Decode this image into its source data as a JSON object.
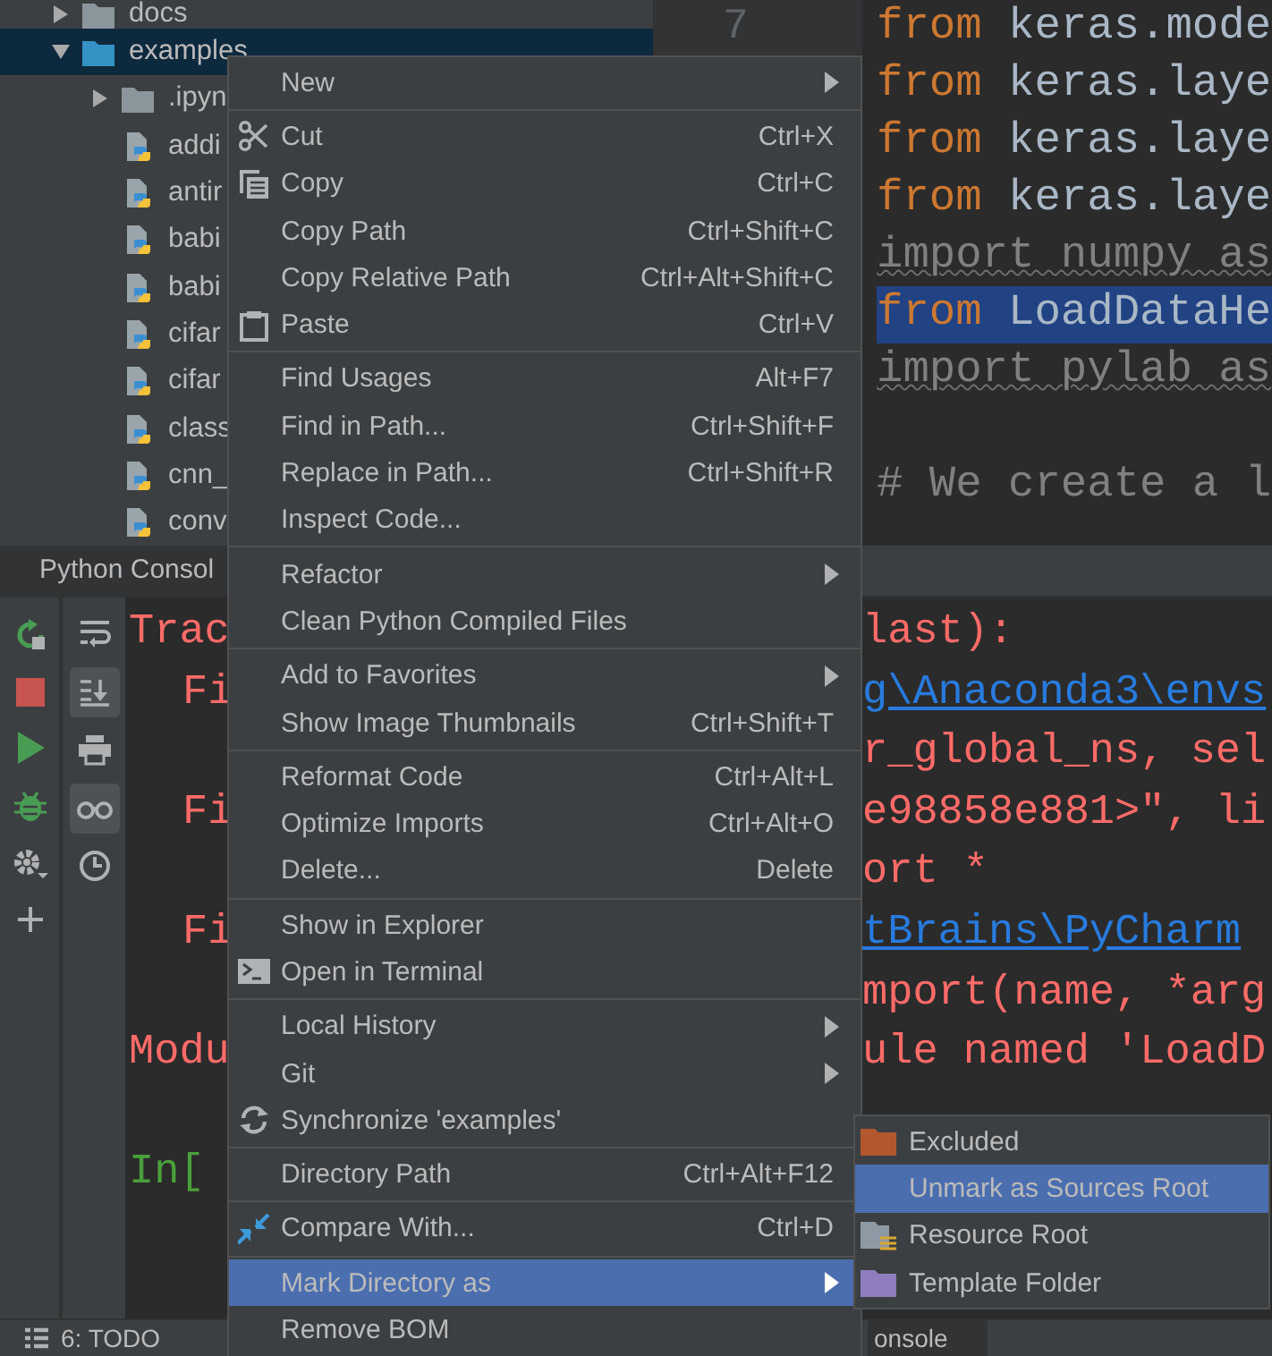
{
  "project_tree": {
    "items": [
      {
        "label": "docs",
        "kind": "folder",
        "expanded": false,
        "selected": false
      },
      {
        "label": "examples",
        "kind": "folder",
        "expanded": true,
        "selected": true,
        "children": [
          {
            "label": ".ipyn",
            "kind": "folder",
            "expanded": false,
            "selected": false
          },
          {
            "label": "addi",
            "kind": "python_file",
            "selected": false
          },
          {
            "label": "antir",
            "kind": "python_file",
            "selected": false
          },
          {
            "label": "babi",
            "kind": "python_file",
            "selected": false
          },
          {
            "label": "babi",
            "kind": "python_file",
            "selected": false
          },
          {
            "label": "cifar",
            "kind": "python_file",
            "selected": false
          },
          {
            "label": "cifar",
            "kind": "python_file",
            "selected": false
          },
          {
            "label": "class",
            "kind": "python_file",
            "selected": false
          },
          {
            "label": "cnn_",
            "kind": "python_file",
            "selected": false
          },
          {
            "label": "conv",
            "kind": "python_file",
            "selected": false
          }
        ]
      }
    ]
  },
  "editor": {
    "line_numbers": [
      "7"
    ],
    "lines": [
      {
        "kind": "import",
        "keyword": "from",
        "text": "keras.mode",
        "selected": false
      },
      {
        "kind": "import",
        "keyword": "from",
        "text": "keras.laye",
        "selected": false
      },
      {
        "kind": "import",
        "keyword": "from",
        "text": "keras.laye",
        "selected": false
      },
      {
        "kind": "import",
        "keyword": "from",
        "text": "keras.laye",
        "selected": false
      },
      {
        "kind": "unused",
        "text": "import numpy as",
        "selected": false
      },
      {
        "kind": "import",
        "keyword": "from",
        "text": "LoadDataHe",
        "selected": true
      },
      {
        "kind": "unused",
        "text": "import pylab as",
        "selected": false
      },
      {
        "kind": "comment",
        "text": "# We create a l",
        "selected": false
      }
    ]
  },
  "console": {
    "tab": {
      "label": "Python Consol",
      "selected": true
    },
    "tools": [
      {
        "kind": "wrap",
        "on": false
      },
      {
        "kind": "scroll_end",
        "on": true
      },
      {
        "kind": "print",
        "on": false
      },
      {
        "kind": "glasses",
        "on": true
      },
      {
        "kind": "history",
        "on": false
      }
    ],
    "lines": [
      {
        "kind": "error",
        "left": "Trac",
        "indented": false,
        "right": "last):"
      },
      {
        "kind": "link",
        "left": "Fi",
        "indented": true,
        "right": "g\\Anaconda3\\envs"
      },
      {
        "kind": "error",
        "right": "r_global_ns, sel"
      },
      {
        "kind": "error",
        "left": "Fi",
        "indented": true,
        "right": "e98858e881>\", li"
      },
      {
        "kind": "error",
        "right": "ort *"
      },
      {
        "kind": "link",
        "left": "Fi",
        "indented": true,
        "right": "tBrains\\PyCharm"
      },
      {
        "kind": "error",
        "right": "mport(name, *arg"
      },
      {
        "kind": "error",
        "left": "Modu",
        "indented": false,
        "right": "ule named 'LoadD"
      },
      {
        "kind": "prompt",
        "left": "In[",
        "indented": false
      }
    ]
  },
  "status_bar": {
    "todo": "6: TODO",
    "console_tab": "onsole"
  },
  "context_menu": {
    "groups": [
      [
        {
          "label": "New",
          "kind": "plain",
          "submenu": true,
          "selected": false
        }
      ],
      [
        {
          "label": "Cut",
          "shortcut": "Ctrl+X",
          "kind": "cut",
          "selected": false
        },
        {
          "label": "Copy",
          "shortcut": "Ctrl+C",
          "kind": "copy",
          "selected": false
        },
        {
          "label": "Copy Path",
          "shortcut": "Ctrl+Shift+C",
          "kind": "plain",
          "selected": false
        },
        {
          "label": "Copy Relative Path",
          "shortcut": "Ctrl+Alt+Shift+C",
          "kind": "plain",
          "selected": false
        },
        {
          "label": "Paste",
          "shortcut": "Ctrl+V",
          "kind": "paste",
          "selected": false
        }
      ],
      [
        {
          "label": "Find Usages",
          "shortcut": "Alt+F7",
          "kind": "plain",
          "selected": false
        },
        {
          "label": "Find in Path...",
          "shortcut": "Ctrl+Shift+F",
          "kind": "plain",
          "selected": false
        },
        {
          "label": "Replace in Path...",
          "shortcut": "Ctrl+Shift+R",
          "kind": "plain",
          "selected": false
        },
        {
          "label": "Inspect Code...",
          "kind": "plain",
          "selected": false
        }
      ],
      [
        {
          "label": "Refactor",
          "kind": "plain",
          "submenu": true,
          "selected": false
        },
        {
          "label": "Clean Python Compiled Files",
          "kind": "plain",
          "selected": false
        }
      ],
      [
        {
          "label": "Add to Favorites",
          "kind": "plain",
          "submenu": true,
          "selected": false
        },
        {
          "label": "Show Image Thumbnails",
          "shortcut": "Ctrl+Shift+T",
          "kind": "plain",
          "selected": false
        }
      ],
      [
        {
          "label": "Reformat Code",
          "shortcut": "Ctrl+Alt+L",
          "kind": "plain",
          "selected": false
        },
        {
          "label": "Optimize Imports",
          "shortcut": "Ctrl+Alt+O",
          "kind": "plain",
          "selected": false
        },
        {
          "label": "Delete...",
          "shortcut": "Delete",
          "kind": "plain",
          "selected": false
        }
      ],
      [
        {
          "label": "Show in Explorer",
          "kind": "plain",
          "selected": false
        },
        {
          "label": "Open in Terminal",
          "kind": "terminal",
          "selected": false
        }
      ],
      [
        {
          "label": "Local History",
          "kind": "plain",
          "submenu": true,
          "selected": false
        },
        {
          "label": "Git",
          "kind": "plain",
          "submenu": true,
          "selected": false
        },
        {
          "label": "Synchronize 'examples'",
          "kind": "sync",
          "selected": false
        }
      ],
      [
        {
          "label": "Directory Path",
          "shortcut": "Ctrl+Alt+F12",
          "kind": "plain",
          "selected": false
        }
      ],
      [
        {
          "label": "Compare With...",
          "shortcut": "Ctrl+D",
          "kind": "compare",
          "selected": false
        }
      ],
      [
        {
          "label": "Mark Directory as",
          "kind": "plain",
          "submenu": true,
          "selected": true
        },
        {
          "label": "Remove BOM",
          "kind": "plain",
          "selected": false
        }
      ]
    ]
  },
  "submenu": {
    "items": [
      {
        "label": "Excluded",
        "kind": "folder",
        "color": "#b3572f",
        "selected": false
      },
      {
        "label": "Unmark as Sources Root",
        "kind": "plain",
        "selected": true
      },
      {
        "label": "Resource Root",
        "kind": "resource_folder",
        "color": "#8e9aa3",
        "selected": false
      },
      {
        "label": "Template Folder",
        "kind": "folder",
        "color": "#8f7dbd",
        "selected": false
      }
    ]
  }
}
